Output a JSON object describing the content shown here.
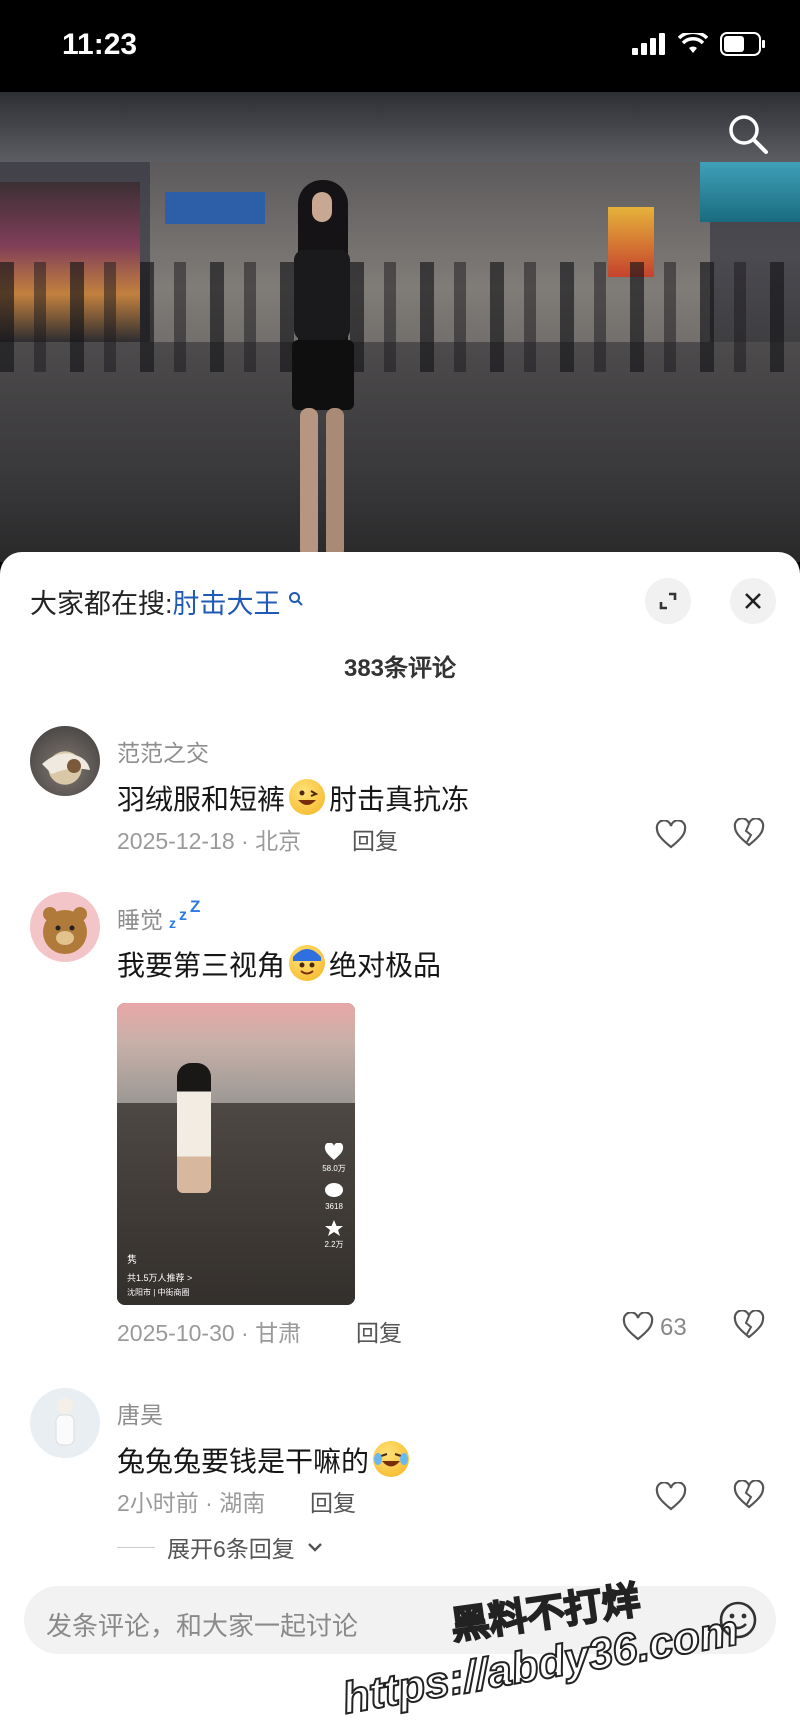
{
  "status_bar": {
    "time": "11:23"
  },
  "header": {
    "trending_prefix": "大家都在搜:",
    "trending_keyword": "肘击大王",
    "comment_count_label": "383条评论"
  },
  "comments": [
    {
      "username": "范范之交",
      "text_before": "羽绒服和短裤",
      "text_after": "肘击真抗冻",
      "date_location": "2025-12-18 · 北京",
      "reply_label": "回复",
      "like_count": ""
    },
    {
      "username": "睡觉",
      "text_before": "我要第三视角",
      "text_after": "绝对极品",
      "date_location": "2025-10-30 · 甘肃",
      "reply_label": "回复",
      "like_count": "63",
      "thumbnail": {
        "likes": "58.0万",
        "comments": "3618",
        "favorites": "2.2万",
        "caption": "隽",
        "recommend": "共1.5万人推荐 >",
        "location": "沈阳市 | 中街商圈"
      }
    },
    {
      "username": "唐昊",
      "text_before": "兔兔兔要钱是干嘛的",
      "text_after": "",
      "date_location": "2小时前 · 湖南",
      "reply_label": "回复",
      "like_count": ""
    }
  ],
  "expand_replies_label": "展开6条回复",
  "input": {
    "placeholder": "发条评论，和大家一起讨论"
  },
  "watermark": {
    "line1": "黑料不打烊",
    "line2": "https://abdy36.com"
  },
  "colors": {
    "accent_link": "#1f5bb5",
    "sheet_bg": "#ffffff"
  }
}
